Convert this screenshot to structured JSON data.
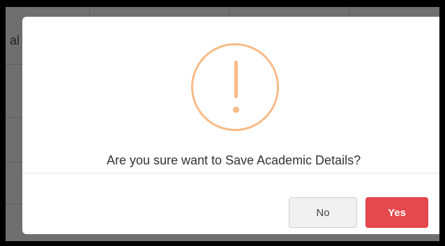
{
  "background": {
    "partial_text": "al"
  },
  "dialog": {
    "icon": "exclamation-circle-icon",
    "message": "Are you sure want to Save Academic Details?",
    "buttons": {
      "no_label": "No",
      "yes_label": "Yes"
    }
  },
  "colors": {
    "warning": "#f8bb86",
    "confirm": "#e5484d",
    "cancel_bg": "#f1f1f1",
    "overlay": "#6f6f6f"
  }
}
